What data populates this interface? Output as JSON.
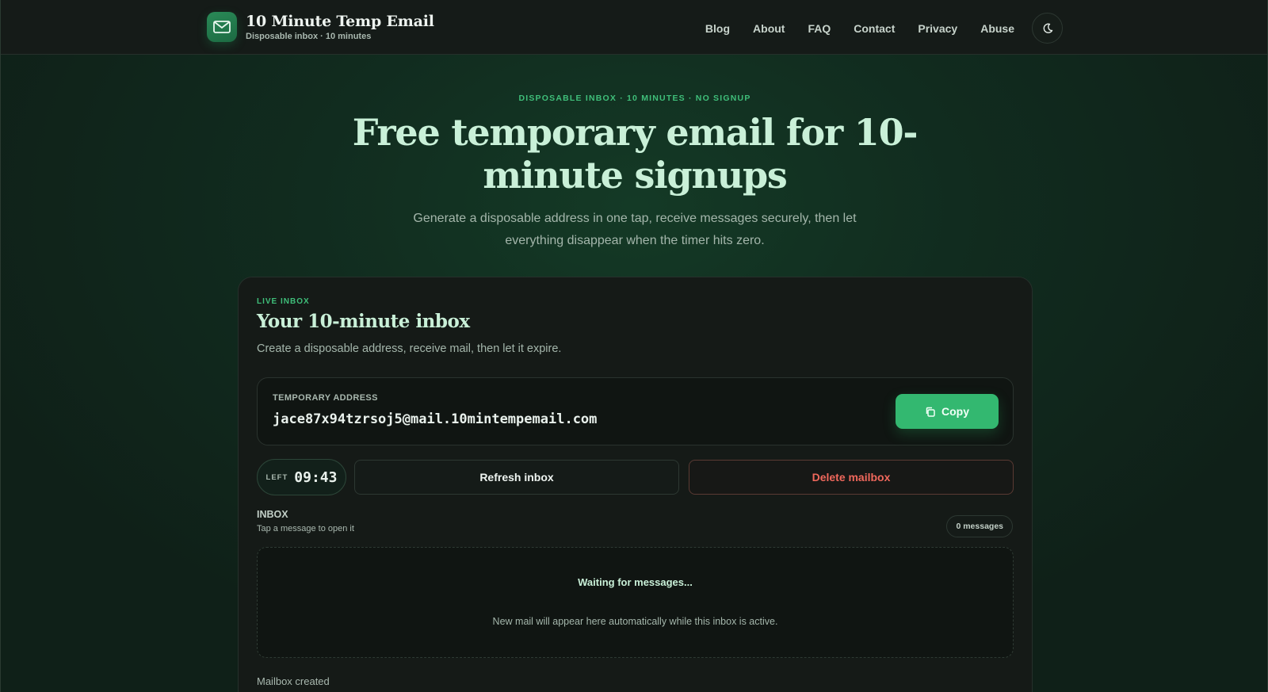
{
  "header": {
    "brand_title": "10 Minute Temp Email",
    "brand_subtitle": "Disposable inbox · 10 minutes",
    "brand_icon": "mail-icon",
    "nav": [
      "Blog",
      "About",
      "FAQ",
      "Contact",
      "Privacy",
      "Abuse"
    ],
    "theme_icon": "moon-icon"
  },
  "hero": {
    "eyebrow": "DISPOSABLE INBOX · 10 MINUTES · NO SIGNUP",
    "title": "Free temporary email for 10-minute signups",
    "subtitle": "Generate a disposable address in one tap, receive messages securely, then let everything disappear when the timer hits zero."
  },
  "card": {
    "eyebrow": "LIVE INBOX",
    "title": "Your 10-minute inbox",
    "subtitle": "Create a disposable address, receive mail, then let it expire.",
    "address_label": "TEMPORARY ADDRESS",
    "address": "jace87x94tzrsoj5@mail.10mintempemail.com",
    "copy_label": "Copy",
    "copy_icon": "copy-icon",
    "timer_label": "LEFT",
    "timer_value": "09:43",
    "refresh_label": "Refresh inbox",
    "delete_label": "Delete mailbox",
    "inbox_label": "INBOX",
    "inbox_hint": "Tap a message to open it",
    "message_count": "0 messages",
    "empty_title": "Waiting for messages...",
    "empty_subtitle": "New mail will appear here automatically while this inbox is active.",
    "status": "Mailbox created"
  },
  "colors": {
    "accent": "#33b870",
    "accent_text": "#3fbf7a",
    "danger": "#f0685c",
    "heading": "#c9f0d8",
    "background": "#112c1f"
  }
}
